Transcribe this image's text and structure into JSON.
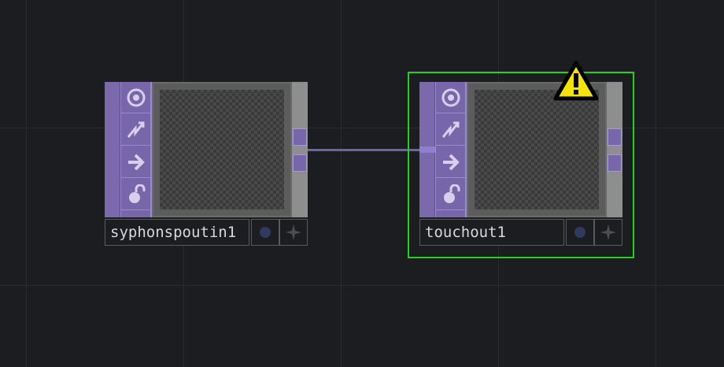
{
  "nodes": [
    {
      "name": "syphonspoutin1",
      "selected": false,
      "warning": false,
      "flags": [
        "viewer-icon",
        "cook-icon",
        "bypass-arrow-icon",
        "lock-icon"
      ]
    },
    {
      "name": "touchout1",
      "selected": true,
      "warning": true,
      "flags": [
        "viewer-icon",
        "cook-icon",
        "bypass-arrow-icon",
        "lock-icon"
      ]
    }
  ],
  "colors": {
    "background": "#1c1d21",
    "grid": "#2a2b30",
    "node_purple": "#7866aa",
    "wire": "#6e62a4",
    "selection": "#22d422",
    "warning": "#f5e400",
    "name_text": "#d8d8d8"
  }
}
